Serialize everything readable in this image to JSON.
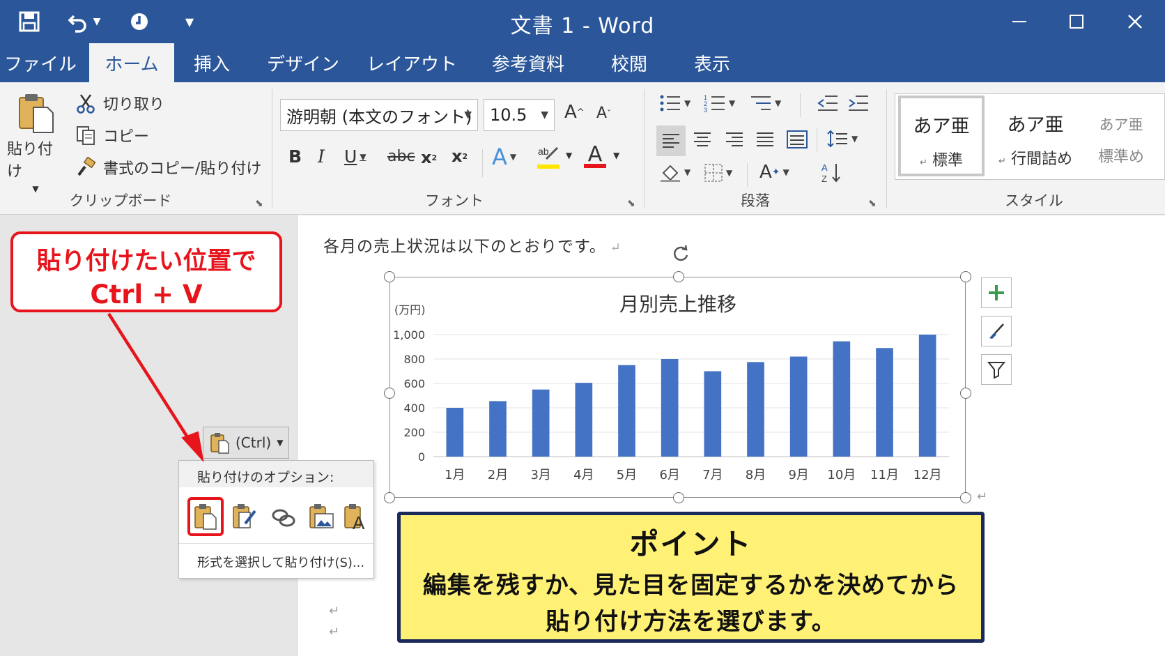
{
  "window": {
    "title": "文書 1  -  Word"
  },
  "tabs": [
    {
      "label": "ファイル"
    },
    {
      "label": "ホーム"
    },
    {
      "label": "挿入"
    },
    {
      "label": "デザイン"
    },
    {
      "label": "レイアウト"
    },
    {
      "label": "参考資料"
    },
    {
      "label": "校閲"
    },
    {
      "label": "表示"
    }
  ],
  "ribbon": {
    "clipboard": {
      "paste_line1": "貼り付け",
      "cut": "切り取り",
      "copy": "コピー",
      "format_painter": "書式のコピー/貼り付け",
      "label": "クリップボード"
    },
    "font": {
      "font_name": "游明朝 (本文のフォント)",
      "font_size": "10.5",
      "label": "フォント",
      "highlight_color": "#ffe600",
      "font_color": "#e8141b"
    },
    "paragraph": {
      "label": "段落"
    },
    "styles": {
      "label": "スタイル",
      "items": [
        {
          "sample": "あア亜",
          "name": "標準"
        },
        {
          "sample": "あア亜",
          "name": "行間詰め"
        },
        {
          "sample": "あア亜",
          "name": "標準め"
        }
      ]
    }
  },
  "document": {
    "text": "各月の売上状況は以下のとおりです。"
  },
  "chart_data": {
    "type": "bar",
    "title": "月別売上推移",
    "ylabel": "(万円)",
    "xlabel": "",
    "categories": [
      "1月",
      "2月",
      "3月",
      "4月",
      "5月",
      "6月",
      "7月",
      "8月",
      "9月",
      "10月",
      "11月",
      "12月"
    ],
    "values": [
      400,
      455,
      550,
      605,
      750,
      800,
      700,
      775,
      820,
      945,
      890,
      1000
    ],
    "ylim": [
      0,
      1000
    ],
    "yticks": [
      "0",
      "200",
      "400",
      "600",
      "800",
      "1,000"
    ],
    "bar_color": "#4472c4",
    "grid": true
  },
  "paste": {
    "ctrl_label": "(Ctrl)",
    "options_header": "貼り付けのオプション:",
    "special": "形式を選択して貼り付け(S)..."
  },
  "callouts": {
    "red_line1": "貼り付けたい位置で",
    "red_line2": "Ctrl + V",
    "point_title": "ポイント",
    "point_line1": "編集を残すか、見た目を固定するかを決めてから",
    "point_line2": "貼り付け方法を選びます。",
    "red_color": "#e8141b",
    "yellow_color": "#fff176"
  }
}
